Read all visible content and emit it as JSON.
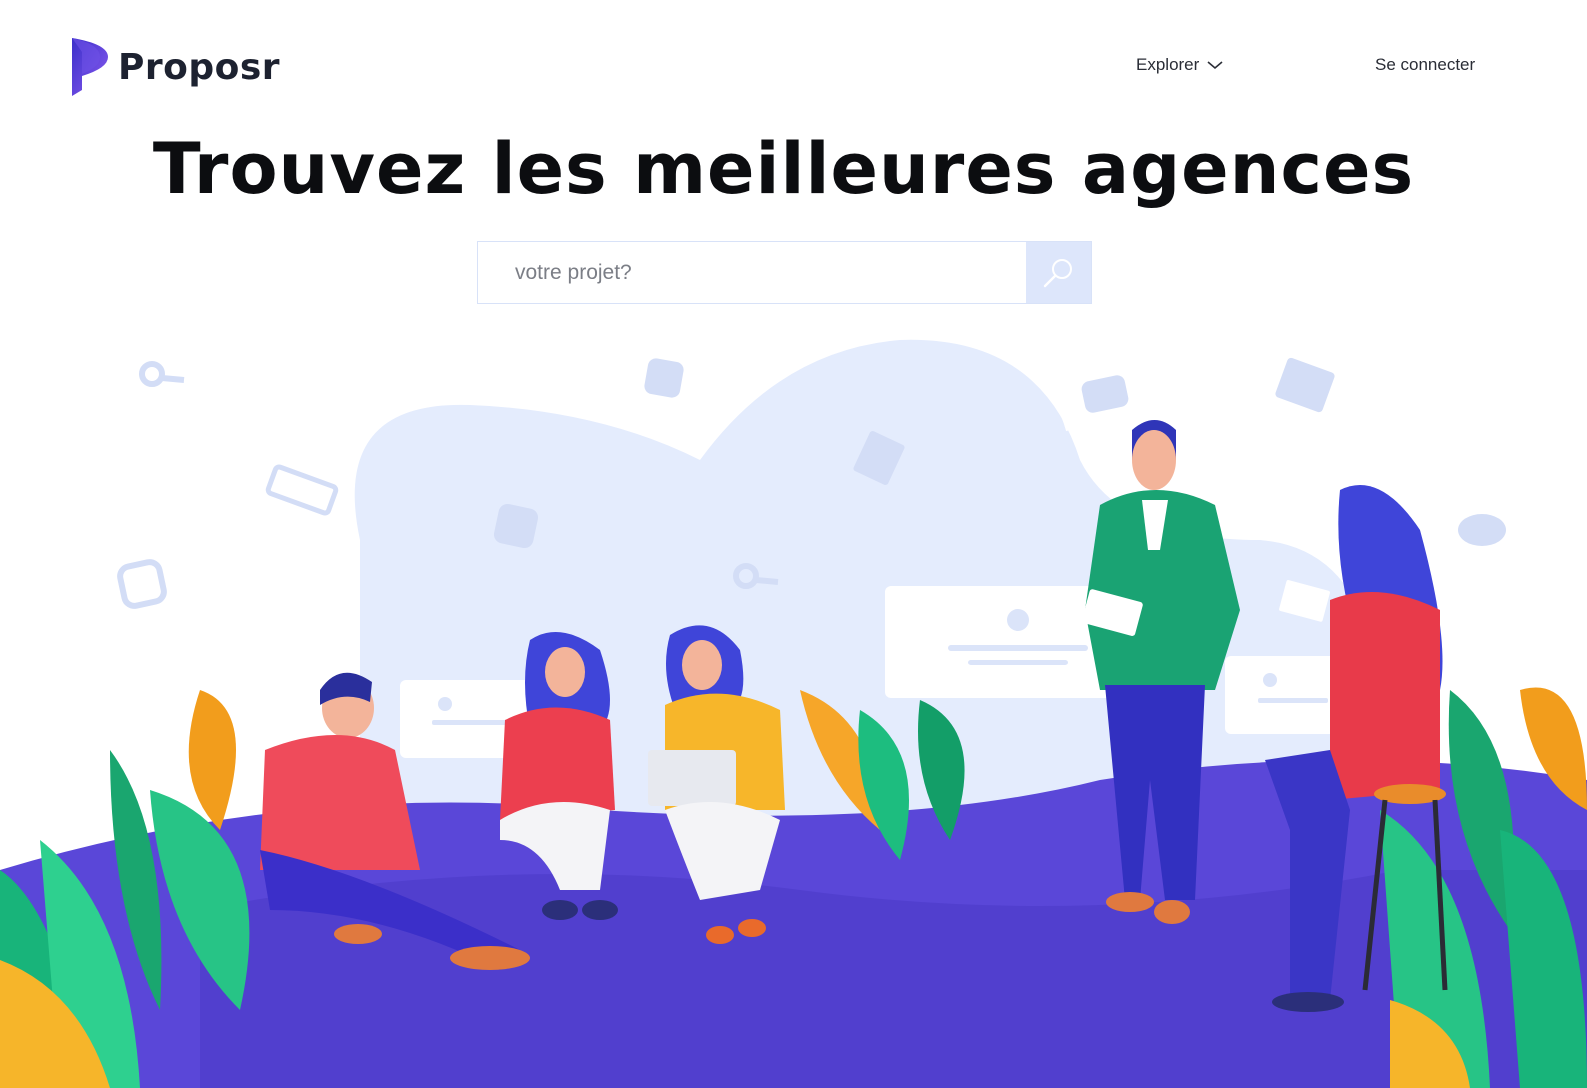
{
  "brand": {
    "name": "Proposr"
  },
  "nav": {
    "explore_label": "Explorer",
    "login_label": "Se connecter"
  },
  "hero": {
    "title": "Trouvez les meilleures agences"
  },
  "search": {
    "placeholder": "votre projet?",
    "value": ""
  },
  "colors": {
    "brand_purple": "#5b3fd6",
    "ground": "#5a47d8",
    "blob": "#e4ecfd",
    "search_button": "#dde6fb"
  },
  "icons": [
    "logo-icon",
    "chevron-down-icon",
    "search-icon",
    "magnifier-deco-icon",
    "facebook-icon",
    "twitter-icon",
    "instagram-icon",
    "youtube-icon",
    "clapperboard-icon",
    "chat-bubble-icon"
  ]
}
